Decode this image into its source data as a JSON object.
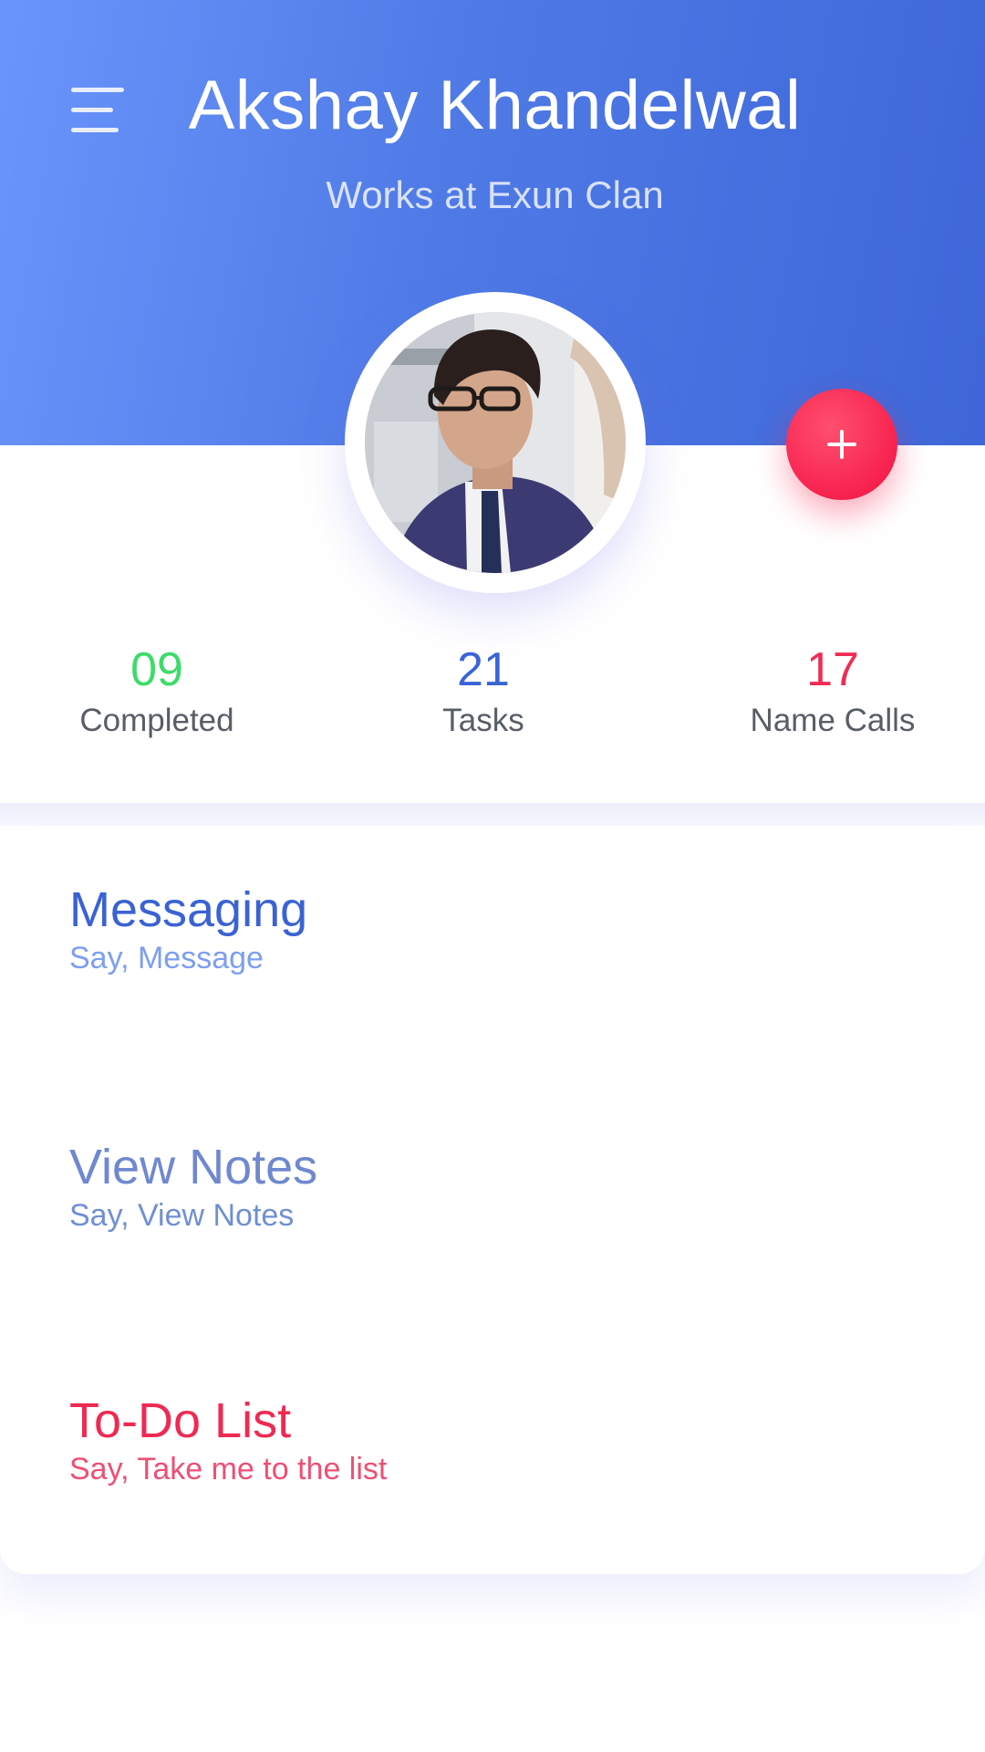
{
  "profile": {
    "name": "Akshay Khandelwal",
    "subtitle": "Works at Exun Clan",
    "avatar_icon": "profile-photo"
  },
  "header": {
    "menu_icon": "hamburger-menu-icon",
    "gradient_colors": [
      "#6a95fb",
      "#3e66d8"
    ]
  },
  "fab": {
    "icon": "plus-icon",
    "color": "#f7224f"
  },
  "stats": [
    {
      "value": "09",
      "label": "Completed",
      "color": "#3ddc6a"
    },
    {
      "value": "21",
      "label": "Tasks",
      "color": "#3a64d6"
    },
    {
      "value": "17",
      "label": "Name Calls",
      "color": "#f02c55"
    }
  ],
  "actions": [
    {
      "title": "Messaging",
      "hint": "Say, Message",
      "color": "#3a62d3"
    },
    {
      "title": "View Notes",
      "hint": "Say, View Notes",
      "color": "#6f88cf"
    },
    {
      "title": "To-Do List",
      "hint": "Say, Take me to the list",
      "color": "#ef2a52"
    }
  ]
}
